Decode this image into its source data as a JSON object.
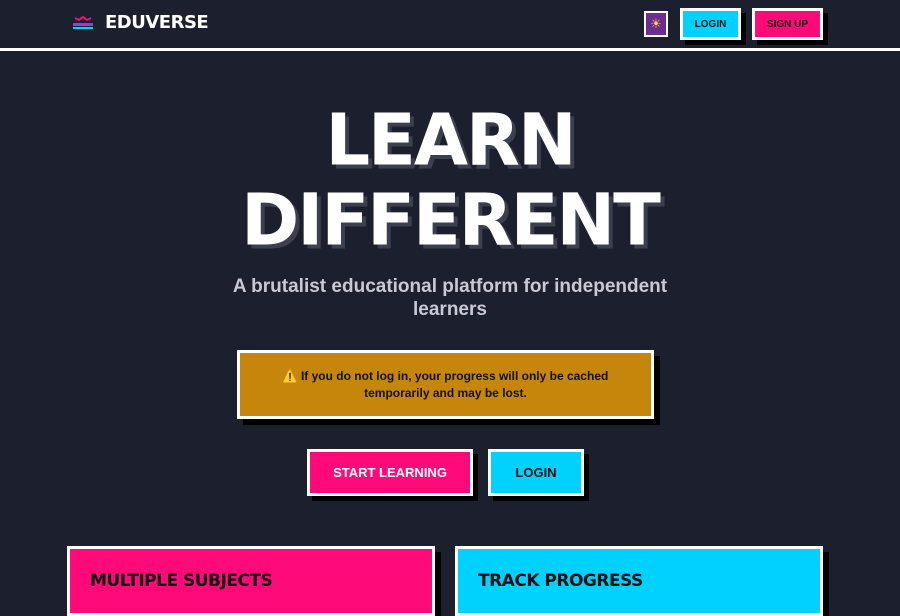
{
  "header": {
    "logo_alt": "EduVerse",
    "brand": "EDUVERSE",
    "theme_icon": "sun-icon",
    "login_label": "LOGIN",
    "signup_label": "SIGN UP"
  },
  "hero": {
    "title_line1": "LEARN",
    "title_line2": "DIFFERENT",
    "subtitle": "A brutalist educational platform for independent learners"
  },
  "warning": {
    "icon": "⚠️",
    "text": "If you do not log in, your progress will only be cached temporarily and may be lost."
  },
  "cta": {
    "start_label": "START LEARNING",
    "login_label": "LOGIN"
  },
  "features": [
    {
      "title": "MULTIPLE SUBJECTS"
    },
    {
      "title": "TRACK PROGRESS"
    }
  ],
  "colors": {
    "background": "#1c1f2e",
    "pink": "#ff0a78",
    "cyan": "#00d1ff",
    "amber": "#c6860b",
    "purple": "#6b2d8f"
  }
}
